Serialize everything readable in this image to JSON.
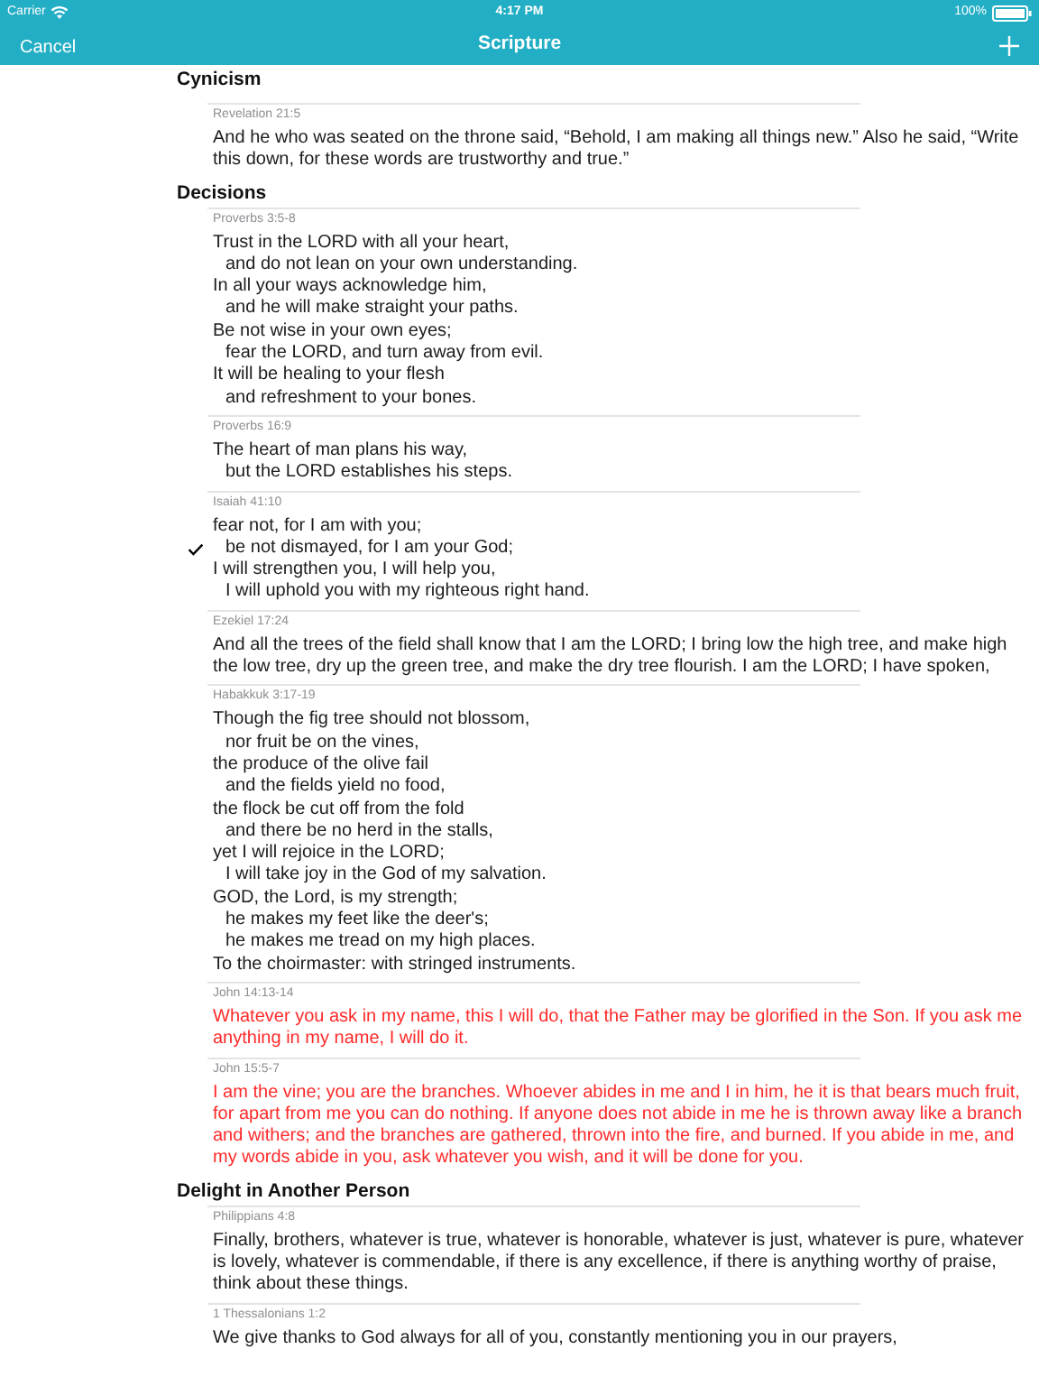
{
  "status_bar": {
    "carrier": "Carrier",
    "time": "4:17 PM",
    "battery": "100%"
  },
  "nav": {
    "left_button": "Cancel",
    "title": "Scripture",
    "add_button": true
  },
  "sections": [
    {
      "title": "Cynicism",
      "verses": [
        {
          "reference": "Revelation 21:5",
          "checked": false,
          "highlighted": false,
          "lines": [
            {
              "text": "And he who was seated on the throne said, “Behold, I am making all things new.” Also he said, “Write this down, for these words are trustworthy and true.”",
              "indent": false
            }
          ]
        }
      ]
    },
    {
      "title": "Decisions",
      "verses": [
        {
          "reference": "Proverbs 3:5-8",
          "checked": false,
          "highlighted": false,
          "lines": [
            {
              "text": "Trust in the LORD with all your heart,",
              "indent": false
            },
            {
              "text": "and do not lean on your own understanding.",
              "indent": true
            },
            {
              "text": "In all your ways acknowledge him,",
              "indent": false
            },
            {
              "text": "and he will make straight your paths.",
              "indent": true
            },
            {
              "text": "Be not wise in your own eyes;",
              "indent": false
            },
            {
              "text": "fear the LORD, and turn away from evil.",
              "indent": true
            },
            {
              "text": "It will be healing to your flesh",
              "indent": false
            },
            {
              "text": "and refreshment to your bones.",
              "indent": true
            }
          ]
        },
        {
          "reference": "Proverbs 16:9",
          "checked": false,
          "highlighted": false,
          "lines": [
            {
              "text": "The heart of man plans his way,",
              "indent": false
            },
            {
              "text": "but the LORD establishes his steps.",
              "indent": true
            }
          ]
        },
        {
          "reference": "Isaiah 41:10",
          "checked": true,
          "highlighted": false,
          "lines": [
            {
              "text": "fear not, for I am with you;",
              "indent": false
            },
            {
              "text": "be not dismayed, for I am your God;",
              "indent": true
            },
            {
              "text": "I will strengthen you, I will help you,",
              "indent": false
            },
            {
              "text": "I will uphold you with my righteous right hand.",
              "indent": true
            }
          ]
        },
        {
          "reference": "Ezekiel 17:24",
          "checked": false,
          "highlighted": false,
          "lines": [
            {
              "text": "And all the trees of the field shall know that I am the LORD; I bring low the high tree, and make high the low tree, dry up the green tree, and make the dry tree flourish. I am the LORD; I have spoken,",
              "indent": false
            }
          ]
        },
        {
          "reference": "Habakkuk 3:17-19",
          "checked": false,
          "highlighted": false,
          "lines": [
            {
              "text": "Though the fig tree should not blossom,",
              "indent": false
            },
            {
              "text": "nor fruit be on the vines,",
              "indent": true
            },
            {
              "text": "the produce of the olive fail",
              "indent": false
            },
            {
              "text": "and the fields yield no food,",
              "indent": true
            },
            {
              "text": "the flock be cut off from the fold",
              "indent": false
            },
            {
              "text": "and there be no herd in the stalls,",
              "indent": true
            },
            {
              "text": "yet I will rejoice in the LORD;",
              "indent": false
            },
            {
              "text": "I will take joy in the God of my salvation.",
              "indent": true
            },
            {
              "text": "GOD, the Lord, is my strength;",
              "indent": false
            },
            {
              "text": "he makes my feet like the deer's;",
              "indent": true
            },
            {
              "text": "he makes me tread on my high places.",
              "indent": true
            },
            {
              "text": "To the choirmaster: with stringed instruments.",
              "indent": false
            }
          ]
        },
        {
          "reference": "John 14:13-14",
          "checked": false,
          "highlighted": true,
          "lines": [
            {
              "text": "Whatever you ask in my name, this I will do, that the Father may be glorified in the Son. If you ask me anything in my name, I will do it.",
              "indent": false
            }
          ]
        },
        {
          "reference": "John 15:5-7",
          "checked": false,
          "highlighted": true,
          "lines": [
            {
              "text": "I am the vine; you are the branches. Whoever abides in me and I in him, he it is that bears much fruit, for apart from me you can do nothing. If anyone does not abide in me he is thrown away like a branch and withers; and the branches are gathered, thrown into the fire, and burned. If you abide in me, and my words abide in you, ask whatever you wish, and it will be done for you.",
              "indent": false
            }
          ]
        }
      ]
    },
    {
      "title": "Delight in Another Person",
      "verses": [
        {
          "reference": "Philippians 4:8",
          "checked": false,
          "highlighted": false,
          "lines": [
            {
              "text": "Finally, brothers, whatever is true, whatever is honorable, whatever is just, whatever is pure, whatever is lovely, whatever is commendable, if there is any excellence, if there is anything worthy of praise, think about these things.",
              "indent": false
            }
          ]
        },
        {
          "reference": "1 Thessalonians 1:2",
          "checked": false,
          "highlighted": false,
          "lines": [
            {
              "text": "We give thanks to God always for all of you, constantly mentioning you in our prayers,",
              "indent": false
            }
          ]
        }
      ]
    }
  ]
}
